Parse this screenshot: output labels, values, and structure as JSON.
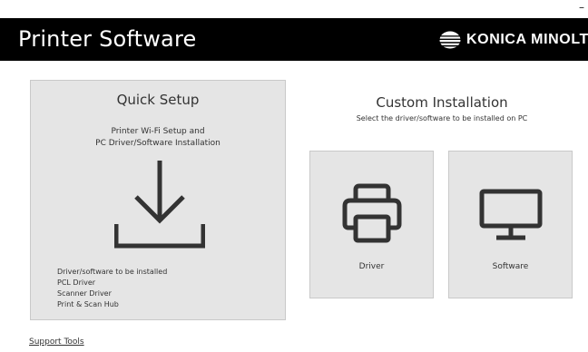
{
  "window": {
    "minimize_glyph": "–"
  },
  "header": {
    "title": "Printer Software",
    "brand": "KONICA MINOLTA",
    "logo_icon": "konica-minolta-globe-logo"
  },
  "quick_setup": {
    "title": "Quick Setup",
    "description_line1": "Printer Wi-Fi Setup and",
    "description_line2": "PC Driver/Software Installation",
    "icon": "download-icon",
    "items": [
      "Driver/software to be installed",
      "PCL Driver",
      "Scanner Driver",
      "Print & Scan Hub"
    ]
  },
  "custom_installation": {
    "title": "Custom Installation",
    "subtitle": "Select the driver/software to be installed on PC",
    "tiles": [
      {
        "label": "Driver",
        "icon": "printer-icon"
      },
      {
        "label": "Software",
        "icon": "monitor-icon"
      }
    ]
  },
  "footer": {
    "support_link": "Support Tools"
  },
  "colors": {
    "header_bg": "#000000",
    "tile_bg": "#e5e5e5",
    "icon": "#333333"
  }
}
